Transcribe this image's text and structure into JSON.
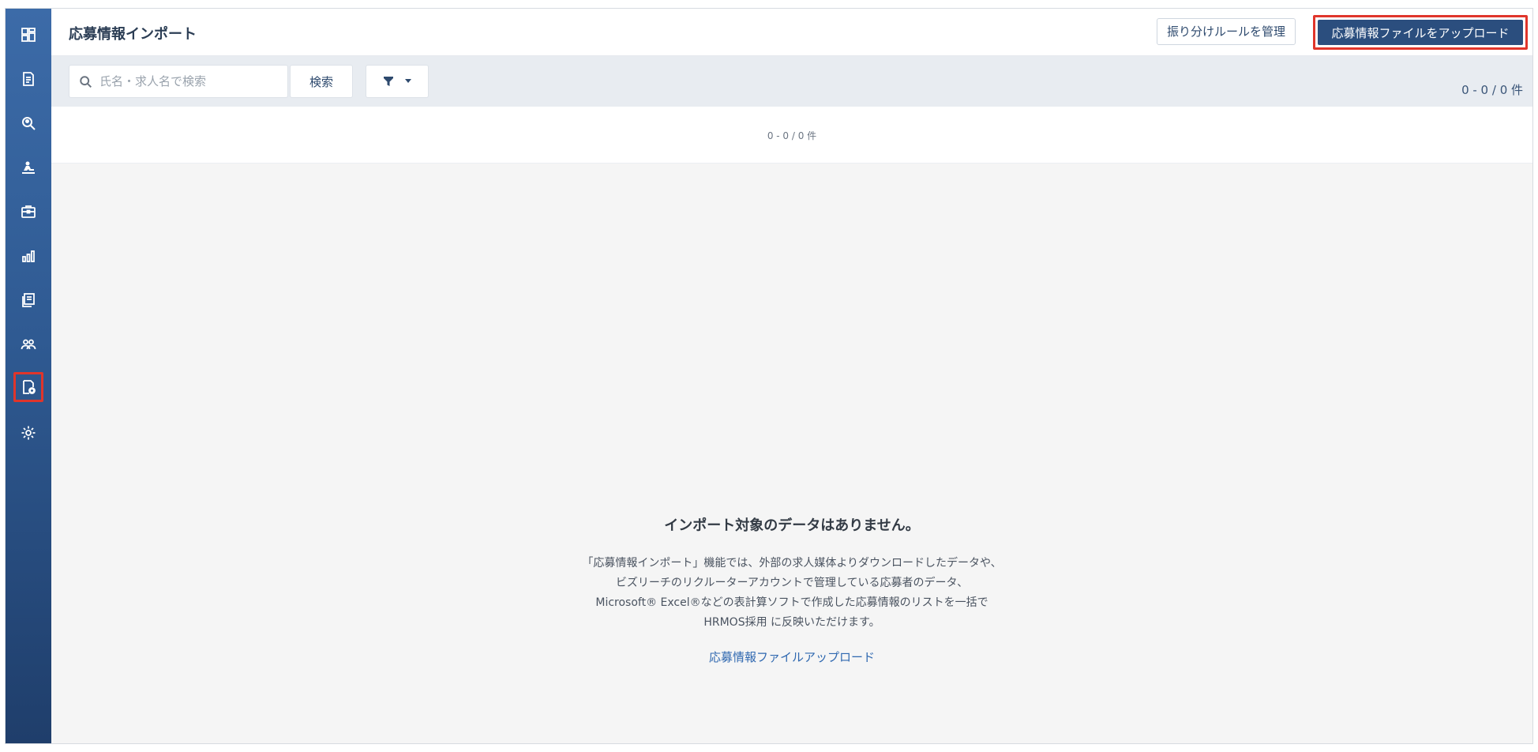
{
  "header": {
    "title": "応募情報インポート",
    "manage_rules_label": "振り分けルールを管理",
    "upload_label": "応募情報ファイルをアップロード"
  },
  "toolbar": {
    "search_placeholder": "氏名・求人名で検索",
    "search_label": "検索",
    "count_label": "0 - 0 / 0 件"
  },
  "list": {
    "count_label": "0 - 0 / 0 件"
  },
  "empty_state": {
    "title": "インポート対象のデータはありません。",
    "lines": [
      "「応募情報インポート」機能では、外部の求人媒体よりダウンロードしたデータや、",
      "ビズリーチのリクルーターアカウントで管理している応募者のデータ、",
      "Microsoft® Excel®などの表計算ソフトで作成した応募情報のリストを一括で",
      "HRMOS採用 に反映いただけます。"
    ],
    "link_label": "応募情報ファイルアップロード"
  },
  "sidebar": {
    "items": [
      {
        "icon": "dashboard-icon"
      },
      {
        "icon": "document-icon"
      },
      {
        "icon": "search-person-icon"
      },
      {
        "icon": "interview-icon"
      },
      {
        "icon": "briefcase-icon"
      },
      {
        "icon": "bar-chart-icon"
      },
      {
        "icon": "cards-icon"
      },
      {
        "icon": "users-icon"
      },
      {
        "icon": "import-icon",
        "active": true
      },
      {
        "icon": "settings-icon"
      }
    ]
  },
  "colors": {
    "sidebar": "#2f5a92",
    "primary": "#2b4e7e",
    "highlight": "#e0352b",
    "link": "#2f68b0"
  }
}
